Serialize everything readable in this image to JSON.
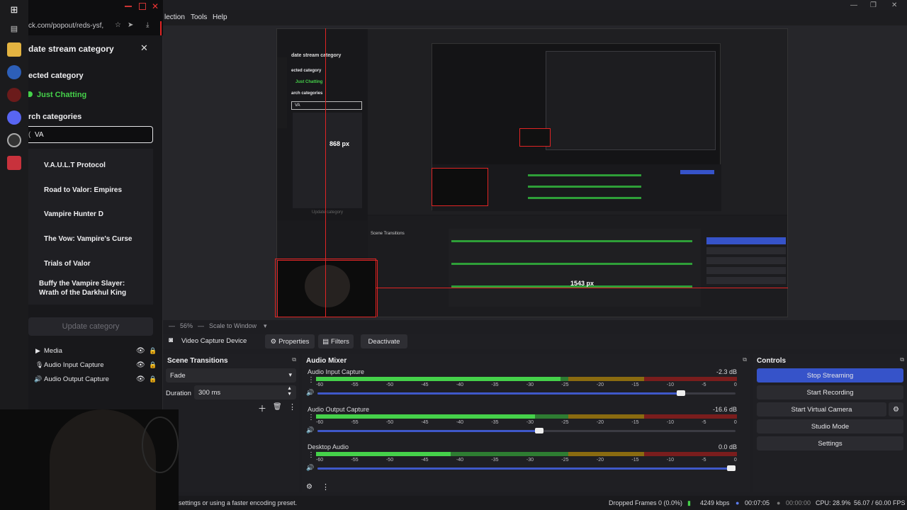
{
  "popout": {
    "url": "ck.com/popout/reds-ysf,",
    "title": "date stream category",
    "selected_heading": "ected category",
    "selected_value": "Just Chatting",
    "search_heading": "rch categories",
    "search_value": "VA",
    "results": [
      "V.A.U.L.T Protocol",
      "Road to Valor: Empires",
      "Vampire Hunter D",
      "The Vow: Vampire's Curse",
      "Trials of Valor",
      "Buffy the Vampire Slayer: Wrath of the Darkhul King"
    ],
    "update_button": "Update category"
  },
  "menu": [
    "lection",
    "Tools",
    "Help"
  ],
  "preview": {
    "overlay_v": "868 px",
    "overlay_h": "1543 px",
    "nested_title": "date stream category",
    "nested_selected_heading": "ected category",
    "nested_selected": "Just Chatting",
    "nested_search_heading": "arch categories",
    "nested_search": "VA",
    "nested_update": "Update category",
    "zoom": "56%",
    "scale": "Scale to Window"
  },
  "sources": [
    "Media",
    "Audio Input Capture",
    "Audio Output Capture"
  ],
  "toolbar": {
    "source_name": "Video Capture Device",
    "properties": "Properties",
    "filters": "Filters",
    "deactivate": "Deactivate"
  },
  "transitions": {
    "title": "Scene Transitions",
    "type": "Fade",
    "duration_label": "Duration",
    "duration_value": "300 ms"
  },
  "mixer": {
    "title": "Audio Mixer",
    "scale": [
      "-60",
      "-55",
      "-50",
      "-45",
      "-40",
      "-35",
      "-30",
      "-25",
      "-20",
      "-15",
      "-10",
      "-5",
      "0"
    ],
    "channels": [
      {
        "name": "Audio Input Capture",
        "db": "-2.3 dB",
        "level": 0.58,
        "volume": 0.87
      },
      {
        "name": "Audio Output Capture",
        "db": "-16.6 dB",
        "level": 0.52,
        "volume": 0.53
      },
      {
        "name": "Desktop Audio",
        "db": "0.0 dB",
        "level": 0.32,
        "volume": 0.99
      }
    ]
  },
  "controls": {
    "title": "Controls",
    "buttons": [
      "Stop Streaming",
      "Start Recording",
      "Start Virtual Camera",
      "Studio Mode",
      "Settings"
    ]
  },
  "status": {
    "message": "settings or using a faster encoding preset.",
    "dropped": "Dropped Frames 0 (0.0%)",
    "bitrate": "4249 kbps",
    "stream_time": "00:07:05",
    "rec_time": "00:00:00",
    "cpu": "CPU: 28.9%",
    "fps": "56.07 / 60.00 FPS"
  },
  "colors": {
    "accent": "#3653c9",
    "twitch_purple": "#9147ff",
    "red": "#e02424",
    "green": "#45d14a"
  }
}
